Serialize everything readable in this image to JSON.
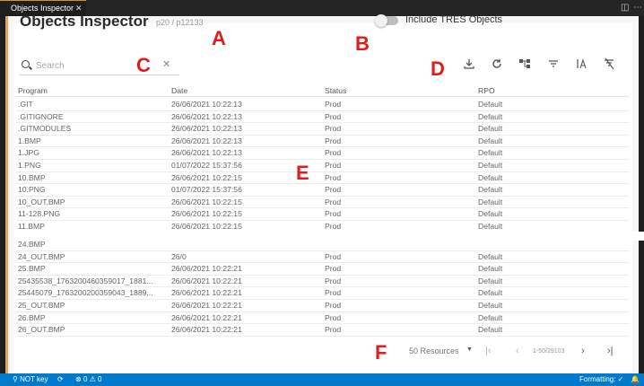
{
  "window": {
    "tab_title": "Objects Inspector"
  },
  "header": {
    "title": "Objects Inspector",
    "subtitle": "p20 / p12133",
    "include_label": "Include TRES Objects"
  },
  "search": {
    "placeholder": "Search",
    "value": ""
  },
  "columns": [
    "Program",
    "Date",
    "Status",
    "RPO"
  ],
  "rows_top": [
    [
      ".GIT",
      "26/06/2021 10:22:13",
      "Prod",
      "Default"
    ],
    [
      ".GITIGNORE",
      "26/06/2021 10:22:13",
      "Prod",
      "Default"
    ],
    [
      ".GITMODULES",
      "26/06/2021 10:22:13",
      "Prod",
      "Default"
    ],
    [
      "1.BMP",
      "26/06/2021 10:22:13",
      "Prod",
      "Default"
    ],
    [
      "1.JPG",
      "26/06/2021 10:22:13",
      "Prod",
      "Default"
    ],
    [
      "1.PNG",
      "01/07/2022 15:37:56",
      "Prod",
      "Default"
    ],
    [
      "10.BMP",
      "26/06/2021 10:22:15",
      "Prod",
      "Default"
    ],
    [
      "10.PNG",
      "01/07/2022 15:37:56",
      "Prod",
      "Default"
    ],
    [
      "10_OUT.BMP",
      "26/06/2021 10:22:15",
      "Prod",
      "Default"
    ],
    [
      "11-128.PNG",
      "26/06/2021 10:22:15",
      "Prod",
      "Default"
    ],
    [
      "11.BMP",
      "26/06/2021 10:22:15",
      "Prod",
      "Default"
    ]
  ],
  "rows_bottom": [
    [
      "24.BMP",
      "",
      "",
      ""
    ],
    [
      "24_OUT.BMP",
      "26/0",
      "Prod",
      "Default"
    ],
    [
      "25.BMP",
      "26/06/2021 10:22:21",
      "Prod",
      "Default"
    ],
    [
      "25435538_1763200460359017_1881...",
      "26/06/2021 10:22:21",
      "Prod",
      "Default"
    ],
    [
      "25445079_1763200200359043_1889...",
      "26/06/2021 10:22:21",
      "Prod",
      "Default"
    ],
    [
      "25_OUT.BMP",
      "26/06/2021 10:22:21",
      "Prod",
      "Default"
    ],
    [
      "26.BMP",
      "26/06/2021 10:22:21",
      "Prod",
      "Default"
    ],
    [
      "26_OUT.BMP",
      "26/06/2021 10:22:21",
      "Prod",
      "Default"
    ]
  ],
  "footer": {
    "per_page": "50 Resources",
    "range": "1-50/29103"
  },
  "marks": {
    "a": "A",
    "b": "B",
    "c": "C",
    "d": "D",
    "e": "E",
    "f": "F"
  },
  "statusbar": {
    "left": "NOT key",
    "problems": "0",
    "warnings": "0",
    "right": "Formatting: ✓"
  },
  "colors": {
    "accent": "#e8a35c",
    "status_bar": "#007acc",
    "marks": "#e21b1b"
  },
  "icons": [
    "search-icon",
    "clear-icon",
    "download-icon",
    "refresh-icon",
    "hierarchy-icon",
    "filter-icon",
    "sort-alpha-icon",
    "clear-filter-icon"
  ]
}
